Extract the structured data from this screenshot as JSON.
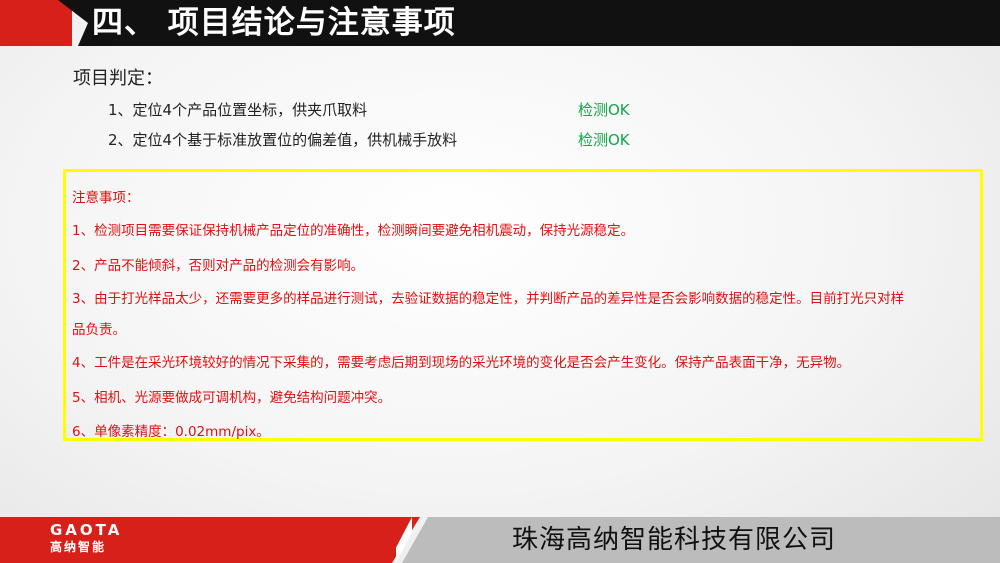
{
  "header": {
    "title": "四、 项目结论与注意事项"
  },
  "verdict": {
    "heading": "项目判定：",
    "items": [
      {
        "label": "1、定位4个产品位置坐标，供夹爪取料",
        "status": "检测OK"
      },
      {
        "label": "2、定位4个基于标准放置位的偏差值，供机械手放料",
        "status": "检测OK"
      }
    ]
  },
  "notes": {
    "heading": "注意事项：",
    "items": [
      "1、检测项目需要保证保持机械产品定位的准确性，检测瞬间要避免相机震动，保持光源稳定。",
      "2、产品不能倾斜，否则对产品的检测会有影响。",
      "3、由于打光样品太少，还需要更多的样品进行测试，去验证数据的稳定性，并判断产品的差异性是否会影响数据的稳定性。目前打光只对样",
      "品负责。",
      "4、工件是在采光环境较好的情况下采集的，需要考虑后期到现场的采光环境的变化是否会产生变化。保持产品表面干净，无异物。",
      "5、相机、光源要做成可调机构，避免结构问题冲突。",
      "6、单像素精度：0.02mm/pix。"
    ]
  },
  "footer": {
    "logo_en": "GAOTA",
    "logo_cn": "高纳智能",
    "company": "珠海高纳智能科技有限公司"
  },
  "colors": {
    "accent_red": "#d7201a",
    "header_black": "#111111",
    "ok_green": "#10a64a",
    "note_red": "#e01010",
    "box_yellow": "#ffff00"
  }
}
